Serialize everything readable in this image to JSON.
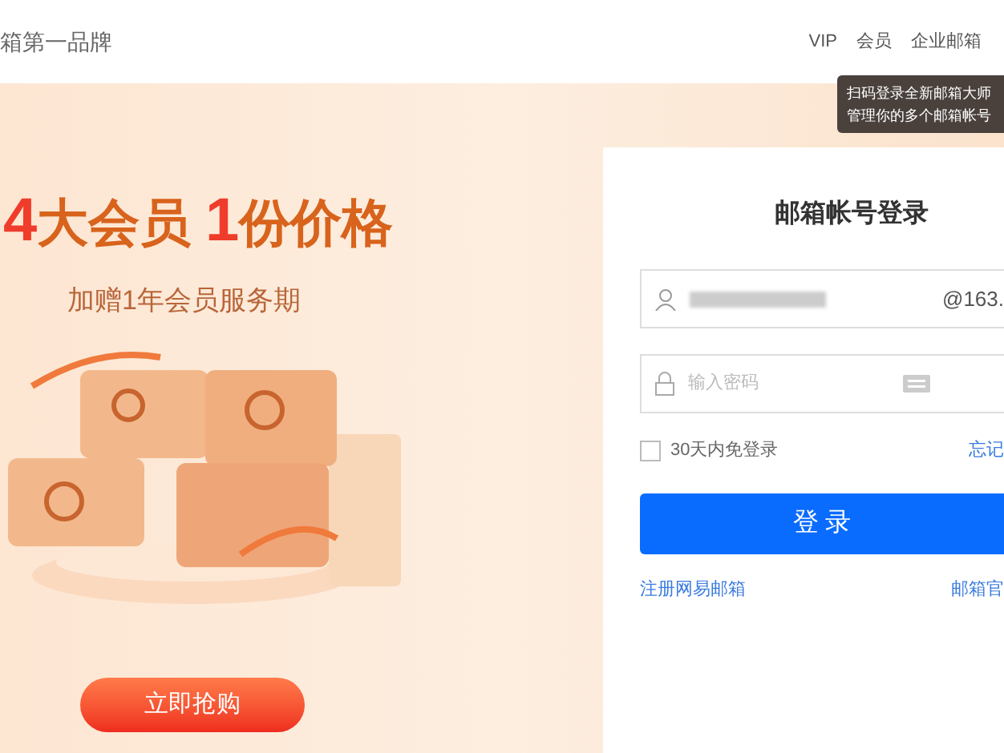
{
  "header": {
    "slogan": "箱第一品牌",
    "nav": [
      "VIP",
      "会员",
      "企业邮箱"
    ]
  },
  "tooltip": {
    "lines": [
      "扫码登录全新邮箱大师",
      "管理你的多个邮箱帐号"
    ]
  },
  "banner": {
    "headline": [
      {
        "text": "4",
        "accent": true
      },
      {
        "text": "大会员 ",
        "accent": false
      },
      {
        "text": "1",
        "accent": true
      },
      {
        "text": "份价格",
        "accent": false
      }
    ],
    "subtitle": "加赠1年会员服务期",
    "button": "立即抢购"
  },
  "login": {
    "title": "邮箱帐号登录",
    "username": {
      "suffix": "@163."
    },
    "password": {
      "placeholder": "输入密码"
    },
    "remember": {
      "label": "30天内免登录",
      "checked": false
    },
    "forgot": "忘记",
    "submit": "登 录",
    "links": [
      "注册网易邮箱",
      "邮箱官"
    ]
  }
}
